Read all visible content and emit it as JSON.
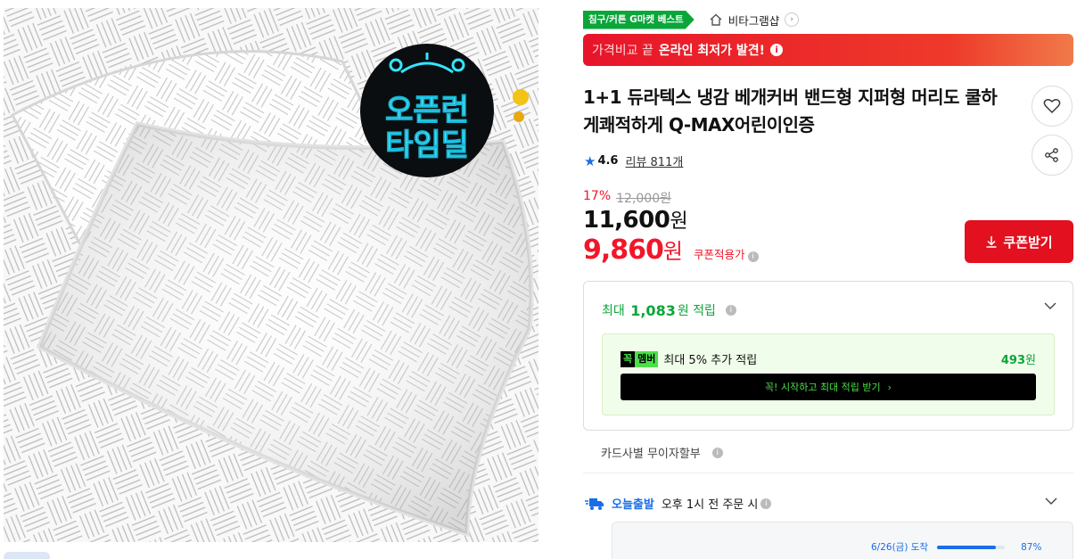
{
  "image": {
    "promo_line1": "오픈런",
    "promo_line2": "타임딜"
  },
  "badges": {
    "best": "침구/커튼 G마켓 베스트",
    "store": "비타그램샵"
  },
  "banner": {
    "prefix": "가격비교 끝",
    "highlight": "온라인 최저가 발견!"
  },
  "product": {
    "title": "1+1 듀라텍스 냉감 베개커버 밴드형 지퍼형 머리도 쿨하게쾌적하게 Q-MAX어린이인증",
    "rating": "4.6",
    "review_label": "리뷰 811개"
  },
  "pricing": {
    "discount_rate": "17%",
    "original_price": "12,000원",
    "price": "11,600",
    "price_unit": "원",
    "coupon_price": "9,860",
    "coupon_unit": "원",
    "coupon_label": "쿠폰적용가",
    "coupon_button": "쿠폰받기"
  },
  "points": {
    "prefix": "최대",
    "amount": "1,083",
    "suffix": "원 적립",
    "member_logo_a": "꼭",
    "member_logo_b": "멤버",
    "member_text": "최대 5% 추가 적립",
    "member_amount": "493",
    "member_amount_unit": "원",
    "member_cta": "꼭! 시작하고 최대 적립 받기",
    "member_cta_arrow": "›"
  },
  "card": {
    "label": "카드사별 무이자할부"
  },
  "shipping": {
    "label": "오늘출발",
    "detail": "오후 1시 전 주문 시",
    "arrival_date": "6/26(금) 도착",
    "arrival_pct_text": "87%",
    "arrival_pct": 0.87
  },
  "colors": {
    "accent_red": "#e3101f",
    "accent_green": "#0aa63a",
    "accent_blue": "#1a6ee8"
  }
}
